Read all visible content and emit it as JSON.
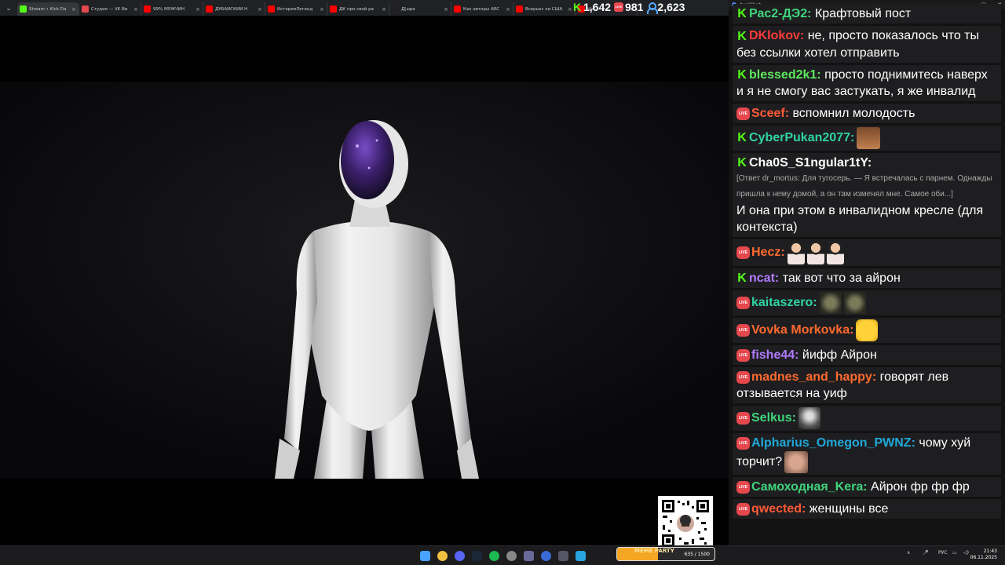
{
  "browser": {
    "tabs": [
      {
        "title": "Stream • Kick Da",
        "icon": "kick-icon",
        "color": "#53fc18",
        "active": true
      },
      {
        "title": "Студия — VK Ви",
        "icon": "vk-video-icon",
        "color": "#e5484d"
      },
      {
        "title": "99% МУЖЧИН",
        "icon": "youtube-icon",
        "color": "#ff0000"
      },
      {
        "title": "ДУБАЙСКИЙ Н",
        "icon": "youtube-icon",
        "color": "#ff0000"
      },
      {
        "title": "ИсторияЛегенд",
        "icon": "youtube-icon",
        "color": "#ff0000"
      },
      {
        "title": "ДК про свой ра",
        "icon": "youtube-icon",
        "color": "#ff0000"
      },
      {
        "title": "Д[ыра",
        "icon": "tiktok-icon",
        "color": "#222222"
      },
      {
        "title": "Как авторы ARC",
        "icon": "youtube-icon",
        "color": "#ff0000"
      },
      {
        "title": "Всерьез ли США",
        "icon": "youtube-icon",
        "color": "#ff0000"
      },
      {
        "title": "Vie",
        "icon": "youtube-icon",
        "color": "#ff0000"
      }
    ]
  },
  "stats": {
    "kick_viewers": "1,642",
    "vk_viewers": "981",
    "total_viewers": "2,623",
    "live_label": "LIVE"
  },
  "chat": {
    "window_title": "AxelChat",
    "messages": [
      {
        "platform": "kick",
        "user": "Рас2-ДЭ2:",
        "user_color": "#3fd47b",
        "text": "Крафтовый пост"
      },
      {
        "platform": "kick",
        "user": "DKlokov:",
        "user_color": "#ff3b3b",
        "text": "не, просто показалось что ты без ссылки хотел отправить"
      },
      {
        "platform": "kick",
        "user": "blessed2k1:",
        "user_color": "#5ee85e",
        "text": "просто поднимитесь наверх и я не смогу вас застукать, я же инвалид"
      },
      {
        "platform": "vk",
        "user": "Sceef:",
        "user_color": "#ff5a36",
        "text": "вспомнил молодость"
      },
      {
        "platform": "kick",
        "user": "CyberPukan2077:",
        "user_color": "#2fd4a0",
        "text": "",
        "emotes": [
          "bear-face-emote"
        ]
      },
      {
        "platform": "kick",
        "user": "Cha0S_S1ngular1tY:",
        "user_color": "#ffffff",
        "reply": "[Ответ dr_mortus: Для тугосерь. — Я встречалась с парнем. Однажды пришла к нему домой, а он там изменял мне. Самое оби...]",
        "text": "И она при этом в инвалидном кресле (для контекста)"
      },
      {
        "platform": "vk",
        "user": "Hecz:",
        "user_color": "#ff6a2e",
        "text": "",
        "emotes": [
          "dancer-emote",
          "dancer-emote",
          "dancer-emote"
        ]
      },
      {
        "platform": "kick",
        "user": "ncat:",
        "user_color": "#b07bff",
        "text": "так вот что за айрон"
      },
      {
        "platform": "vk",
        "user": "kaitaszero:",
        "user_color": "#2fd4a0",
        "text": "",
        "emotes": [
          "creature-emote",
          "creature-emote"
        ]
      },
      {
        "platform": "vk",
        "user": "Vovka Morkovka:",
        "user_color": "#ff6a2e",
        "text": "",
        "emotes": [
          "smile-emote"
        ]
      },
      {
        "platform": "vk",
        "user": "fishe44:",
        "user_color": "#b07bff",
        "text": "йифф Айрон"
      },
      {
        "platform": "vk",
        "user": "madnes_and_happy:",
        "user_color": "#ff6a2e",
        "text": "говорят лев отзывается на уиф"
      },
      {
        "platform": "vk",
        "user": "Selkus:",
        "user_color": "#3fd47b",
        "text": "",
        "emotes": [
          "frog-emote"
        ]
      },
      {
        "platform": "vk",
        "user": "Alpharius_Omegon_PWNZ:",
        "user_color": "#1fa8d8",
        "text": "чому хуй торчит?",
        "emotes": [
          "face-emote"
        ]
      },
      {
        "platform": "vk",
        "user": "Самоходная_Kera:",
        "user_color": "#3fd47b",
        "text": "Айрон фр фр фр"
      },
      {
        "platform": "vk",
        "user": "qwected:",
        "user_color": "#ff5a36",
        "text": "женщины все"
      }
    ]
  },
  "widget": {
    "label": "MEME PARTY",
    "value": "635 / 1500",
    "progress": 0.42
  },
  "taskbar": {
    "language": "РУС",
    "time": "21:43",
    "date": "06.11.2025"
  }
}
